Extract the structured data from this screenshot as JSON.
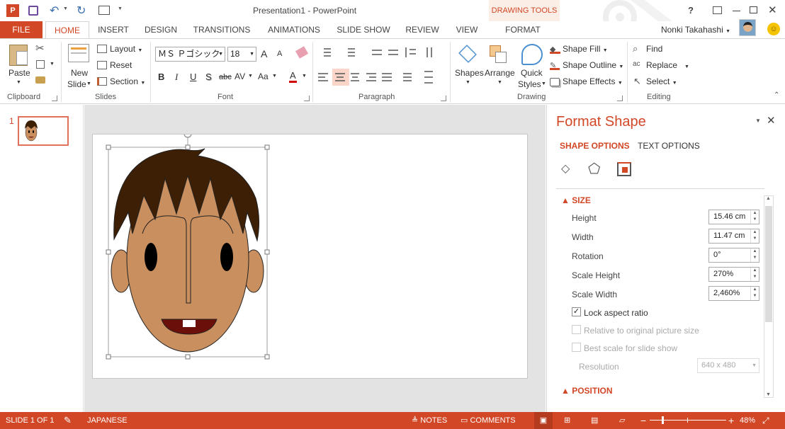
{
  "window": {
    "title": "Presentation1 - PowerPoint",
    "contextual_group": "DRAWING TOOLS",
    "help": "?",
    "user_name": "Nonki Takahashi"
  },
  "tabs": [
    {
      "label": "FILE"
    },
    {
      "label": "HOME"
    },
    {
      "label": "INSERT"
    },
    {
      "label": "DESIGN"
    },
    {
      "label": "TRANSITIONS"
    },
    {
      "label": "ANIMATIONS"
    },
    {
      "label": "SLIDE SHOW"
    },
    {
      "label": "REVIEW"
    },
    {
      "label": "VIEW"
    },
    {
      "label": "FORMAT"
    }
  ],
  "ribbon": {
    "clipboard": {
      "paste": "Paste",
      "group": "Clipboard"
    },
    "slides": {
      "new_slide_1": "New",
      "new_slide_2": "Slide",
      "layout": "Layout",
      "reset": "Reset",
      "section": "Section",
      "group": "Slides"
    },
    "font": {
      "font_name": "ＭＳ Ｐゴシック",
      "font_size": "18",
      "grow": "A",
      "shrink": "A",
      "bold": "B",
      "italic": "I",
      "underline": "U",
      "shadow": "S",
      "strike": "abc",
      "spacing": "AV",
      "case": "Aa",
      "color": "A",
      "group": "Font"
    },
    "paragraph": {
      "group": "Paragraph"
    },
    "drawing": {
      "shapes": "Shapes",
      "arrange": "Arrange",
      "quick_1": "Quick",
      "quick_2": "Styles",
      "fill": "Shape Fill",
      "outline": "Shape Outline",
      "effects": "Shape Effects",
      "group": "Drawing"
    },
    "editing": {
      "find": "Find",
      "replace": "Replace",
      "select": "Select",
      "group": "Editing"
    }
  },
  "slides_pane": {
    "slide_number": "1"
  },
  "format_pane": {
    "title": "Format Shape",
    "tab_shape": "SHAPE OPTIONS",
    "tab_text": "TEXT OPTIONS",
    "section_size": "SIZE",
    "section_position": "POSITION",
    "fields": [
      {
        "label": "Height",
        "value": "15.46 cm"
      },
      {
        "label": "Width",
        "value": "11.47 cm"
      },
      {
        "label": "Rotation",
        "value": "0°"
      },
      {
        "label": "Scale Height",
        "value": "270%"
      },
      {
        "label": "Scale Width",
        "value": "2,460%"
      }
    ],
    "lock_aspect": "Lock aspect ratio",
    "relative": "Relative to original picture size",
    "best_scale": "Best scale for slide show",
    "resolution_label": "Resolution",
    "resolution_value": "640 x 480"
  },
  "statusbar": {
    "slide": "SLIDE 1 OF 1",
    "language": "JAPANESE",
    "notes": "NOTES",
    "comments": "COMMENTS",
    "zoom": "48%"
  },
  "colors": {
    "accent": "#d24726",
    "hair": "#3d1f05",
    "skin": "#c98f5f",
    "mouth": "#6b0f0a"
  }
}
